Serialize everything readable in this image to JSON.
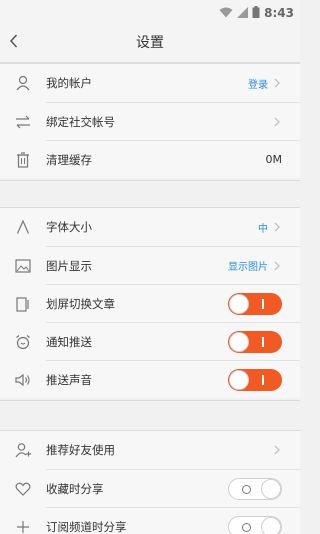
{
  "status_bar": {
    "time": "8:43"
  },
  "header": {
    "title": "设置"
  },
  "groups": [
    {
      "rows": [
        {
          "label": "我的帐户",
          "value": "登录"
        },
        {
          "label": "绑定社交帐号"
        },
        {
          "label": "清理缓存",
          "value": "0M"
        }
      ]
    },
    {
      "rows": [
        {
          "label": "字体大小",
          "value": "中"
        },
        {
          "label": "图片显示",
          "value": "显示图片"
        },
        {
          "label": "划屏切换文章",
          "toggle": "on"
        },
        {
          "label": "通知推送",
          "toggle": "on"
        },
        {
          "label": "推送声音",
          "toggle": "on"
        }
      ]
    },
    {
      "rows": [
        {
          "label": "推荐好友使用"
        },
        {
          "label": "收藏时分享",
          "toggle": "off"
        },
        {
          "label": "订阅频道时分享",
          "toggle": "off"
        }
      ]
    }
  ],
  "colors": {
    "accent": "#f15a22",
    "link": "#2b8de0"
  }
}
